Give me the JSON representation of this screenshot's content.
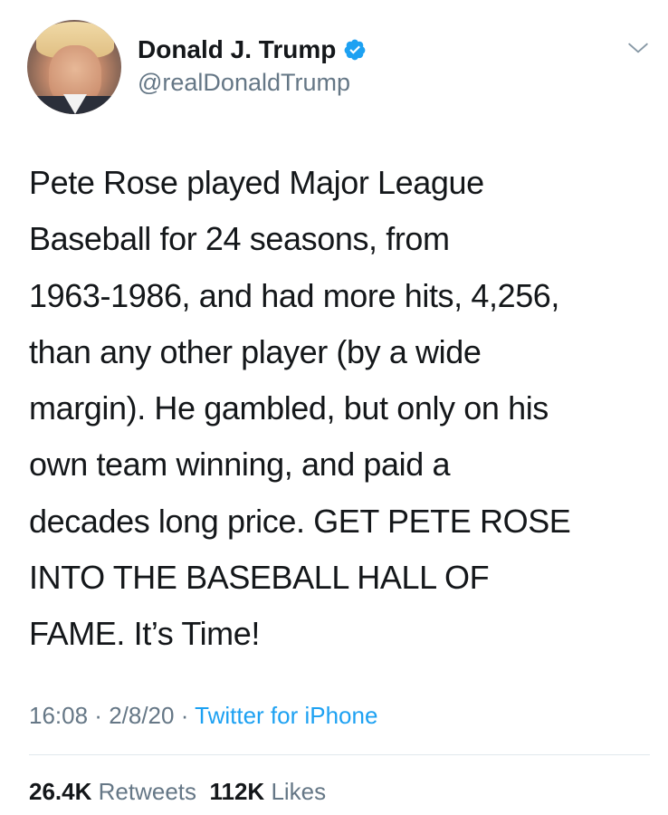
{
  "author": {
    "display_name": "Donald J. Trump",
    "handle": "@realDonaldTrump",
    "verified": true
  },
  "tweet": {
    "text": "Pete Rose played Major League\nBaseball for 24 seasons, from\n1963-1986, and had more hits, 4,256,\nthan any other player (by a wide\nmargin). He gambled, but only on his\nown team winning, and paid a\ndecades long price. GET PETE ROSE\nINTO THE BASEBALL HALL OF\nFAME. It’s Time!",
    "time": "16:08",
    "date": "2/8/20",
    "separator": " · ",
    "source": "Twitter for iPhone"
  },
  "stats": {
    "retweets_count": "26.4K",
    "retweets_label": "Retweets",
    "likes_count": "112K",
    "likes_label": "Likes"
  },
  "icons": {
    "verified": "verified-badge-icon",
    "menu": "chevron-down-icon"
  },
  "colors": {
    "text": "#14171a",
    "secondary": "#657786",
    "accent": "#1da1f2",
    "divider": "#e1e8ed"
  }
}
